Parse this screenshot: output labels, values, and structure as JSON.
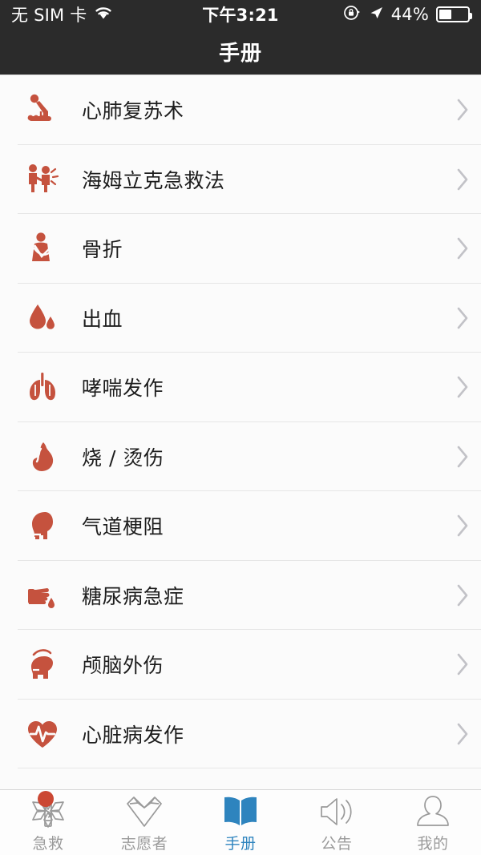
{
  "status_bar": {
    "carrier": "无 SIM 卡",
    "wifi_icon": "wifi-icon",
    "time": "下午3:21",
    "rotation_lock_icon": "rotation-lock-icon",
    "location_icon": "location-arrow-icon",
    "battery_percent": "44%",
    "battery_level": 44
  },
  "header": {
    "title": "手册"
  },
  "manual_list": {
    "items": [
      {
        "label": "心肺复苏术",
        "icon": "cpr-icon",
        "chevron": "chevron-right-icon"
      },
      {
        "label": "海姆立克急救法",
        "icon": "heimlich-icon",
        "chevron": "chevron-right-icon"
      },
      {
        "label": "骨折",
        "icon": "arm-sling-fracture-icon",
        "chevron": "chevron-right-icon"
      },
      {
        "label": "出血",
        "icon": "blood-drop-icon",
        "chevron": "chevron-right-icon"
      },
      {
        "label": "哮喘发作",
        "icon": "lungs-icon",
        "chevron": "chevron-right-icon"
      },
      {
        "label": "烧 / 烫伤",
        "icon": "flame-icon",
        "chevron": "chevron-right-icon"
      },
      {
        "label": "气道梗阻",
        "icon": "airway-obstruction-icon",
        "chevron": "chevron-right-icon"
      },
      {
        "label": "糖尿病急症",
        "icon": "finger-blood-drop-icon",
        "chevron": "chevron-right-icon"
      },
      {
        "label": "颅脑外伤",
        "icon": "head-injury-icon",
        "chevron": "chevron-right-icon"
      },
      {
        "label": "心脏病发作",
        "icon": "heart-pulse-icon",
        "chevron": "chevron-right-icon"
      }
    ]
  },
  "tab_bar": {
    "items": [
      {
        "label": "急救",
        "icon": "star-of-life-icon",
        "active": false,
        "badge": true
      },
      {
        "label": "志愿者",
        "icon": "heart-outline-icon",
        "active": false,
        "badge": false
      },
      {
        "label": "手册",
        "icon": "open-book-icon",
        "active": true,
        "badge": false
      },
      {
        "label": "公告",
        "icon": "speaker-icon",
        "active": false,
        "badge": false
      },
      {
        "label": "我的",
        "icon": "person-icon",
        "active": false,
        "badge": false
      }
    ]
  },
  "colors": {
    "header_bg": "#2b2b2b",
    "icon_red": "#c5523e",
    "active_blue": "#2e84be",
    "inactive_grey": "#9a9a9a",
    "list_bg": "#fbfbfb",
    "badge_red": "#cb4733"
  }
}
